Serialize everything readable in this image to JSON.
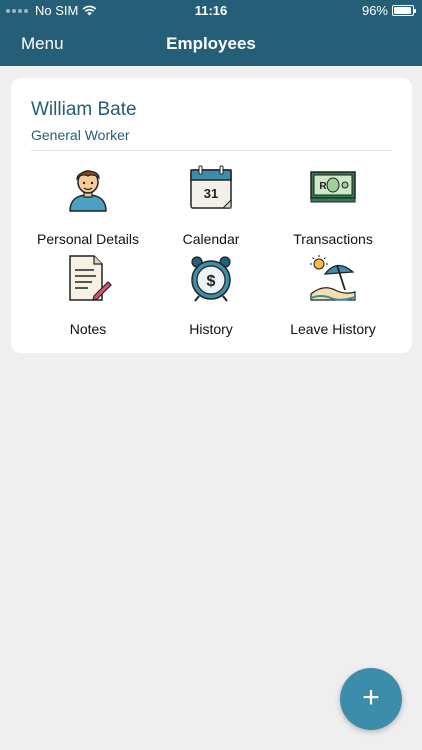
{
  "status_bar": {
    "carrier": "No SIM",
    "time": "11:16",
    "battery": "96%",
    "battery_level": 0.96
  },
  "navbar": {
    "menu_label": "Menu",
    "title": "Employees"
  },
  "employee": {
    "name": "William Bate",
    "role": "General Worker"
  },
  "tiles": [
    {
      "label": "Personal Details",
      "icon": "person-icon"
    },
    {
      "label": "Calendar",
      "icon": "calendar-icon",
      "icon_text": "31"
    },
    {
      "label": "Transactions",
      "icon": "money-icon",
      "icon_text": "R"
    },
    {
      "label": "Notes",
      "icon": "notes-icon"
    },
    {
      "label": "History",
      "icon": "clock-money-icon"
    },
    {
      "label": "Leave History",
      "icon": "beach-icon"
    }
  ],
  "fab": {
    "label": "+"
  },
  "colors": {
    "header": "#255e77",
    "accent": "#3c8dab",
    "background": "#efeff0"
  }
}
